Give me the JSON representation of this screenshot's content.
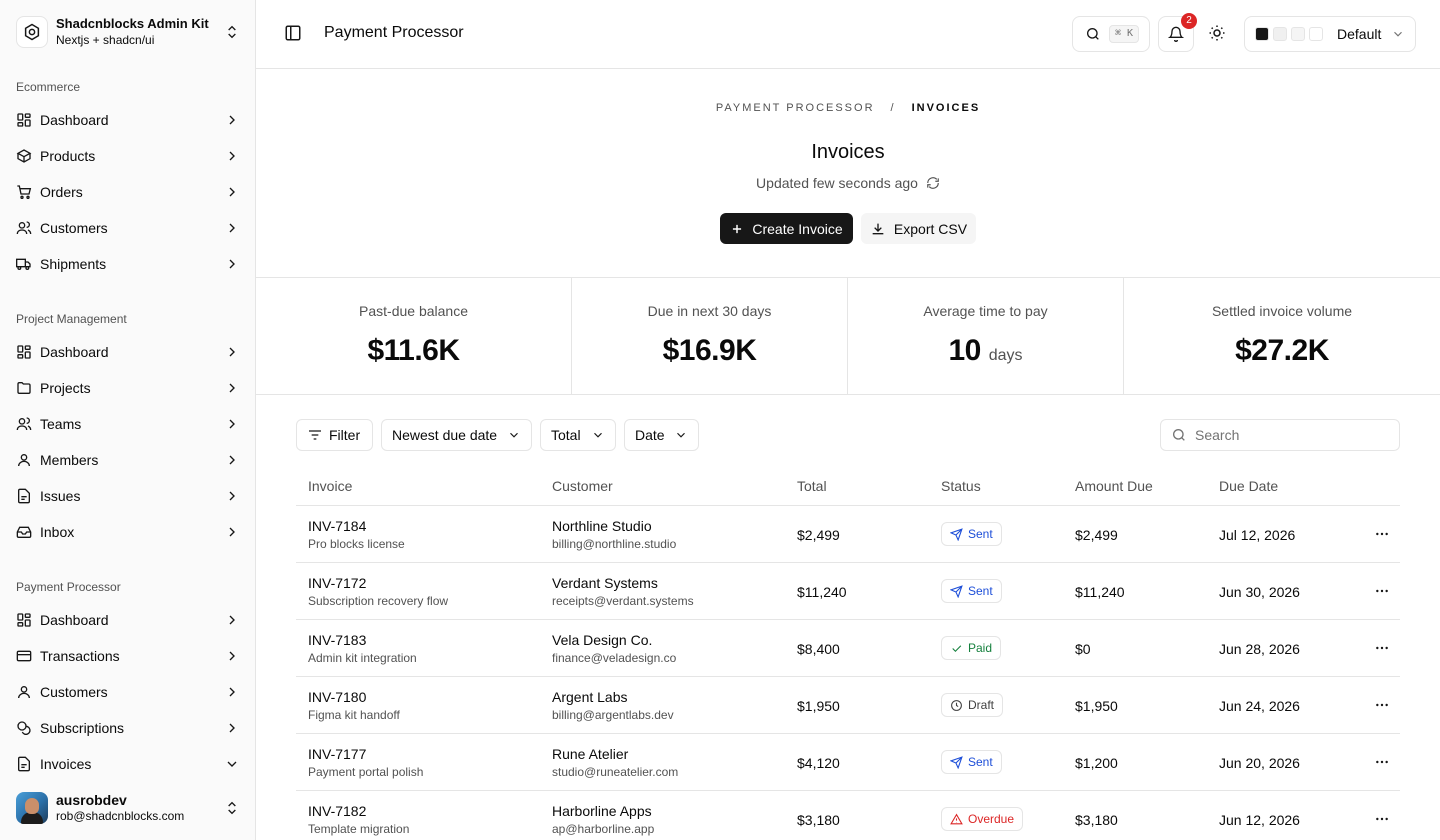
{
  "team": {
    "name": "Shadcnblocks Admin Kit",
    "subtitle": "Nextjs + shadcn/ui"
  },
  "nav_groups": [
    {
      "label": "Ecommerce",
      "items": [
        "Dashboard",
        "Products",
        "Orders",
        "Customers",
        "Shipments"
      ]
    },
    {
      "label": "Project Management",
      "items": [
        "Dashboard",
        "Projects",
        "Teams",
        "Members",
        "Issues",
        "Inbox"
      ]
    },
    {
      "label": "Payment Processor",
      "items": [
        "Dashboard",
        "Transactions",
        "Customers",
        "Subscriptions",
        "Invoices"
      ]
    }
  ],
  "user": {
    "name": "ausrobdev",
    "email": "rob@shadcnblocks.com"
  },
  "header": {
    "title": "Payment Processor",
    "search_kbd": "⌘ K",
    "notification_count": "2",
    "theme_label": "Default",
    "swatches": [
      "#171717",
      "#f0f0f0",
      "#f5f5f5",
      "#ffffff"
    ]
  },
  "breadcrumb": {
    "parent": "PAYMENT PROCESSOR",
    "separator": "/",
    "current": "INVOICES"
  },
  "page": {
    "title": "Invoices",
    "updated": "Updated few seconds ago",
    "create_label": "Create Invoice",
    "export_label": "Export CSV"
  },
  "stats": [
    {
      "label": "Past-due balance",
      "value": "$11.6K",
      "unit": ""
    },
    {
      "label": "Due in next 30 days",
      "value": "$16.9K",
      "unit": ""
    },
    {
      "label": "Average time to pay",
      "value": "10",
      "unit": "days"
    },
    {
      "label": "Settled invoice volume",
      "value": "$27.2K",
      "unit": ""
    }
  ],
  "toolbar": {
    "filter_label": "Filter",
    "sort_label": "Newest due date",
    "total_label": "Total",
    "date_label": "Date",
    "search_placeholder": "Search"
  },
  "table": {
    "headers": [
      "Invoice",
      "Customer",
      "Total",
      "Status",
      "Amount Due",
      "Due Date"
    ],
    "rows": [
      {
        "id": "INV-7184",
        "desc": "Pro blocks license",
        "customer": "Northline Studio",
        "email": "billing@northline.studio",
        "total": "$2,499",
        "status": "Sent",
        "due_amount": "$2,499",
        "due_date": "Jul 12, 2026"
      },
      {
        "id": "INV-7172",
        "desc": "Subscription recovery flow",
        "customer": "Verdant Systems",
        "email": "receipts@verdant.systems",
        "total": "$11,240",
        "status": "Sent",
        "due_amount": "$11,240",
        "due_date": "Jun 30, 2026"
      },
      {
        "id": "INV-7183",
        "desc": "Admin kit integration",
        "customer": "Vela Design Co.",
        "email": "finance@veladesign.co",
        "total": "$8,400",
        "status": "Paid",
        "due_amount": "$0",
        "due_date": "Jun 28, 2026"
      },
      {
        "id": "INV-7180",
        "desc": "Figma kit handoff",
        "customer": "Argent Labs",
        "email": "billing@argentlabs.dev",
        "total": "$1,950",
        "status": "Draft",
        "due_amount": "$1,950",
        "due_date": "Jun 24, 2026"
      },
      {
        "id": "INV-7177",
        "desc": "Payment portal polish",
        "customer": "Rune Atelier",
        "email": "studio@runeatelier.com",
        "total": "$4,120",
        "status": "Sent",
        "due_amount": "$1,200",
        "due_date": "Jun 20, 2026"
      },
      {
        "id": "INV-7182",
        "desc": "Template migration",
        "customer": "Harborline Apps",
        "email": "ap@harborline.app",
        "total": "$3,180",
        "status": "Overdue",
        "due_amount": "$3,180",
        "due_date": "Jun 12, 2026"
      }
    ]
  },
  "status_colors": {
    "Sent": "#1d4ed8",
    "Paid": "#15803d",
    "Draft": "#404040",
    "Overdue": "#dc2626"
  }
}
